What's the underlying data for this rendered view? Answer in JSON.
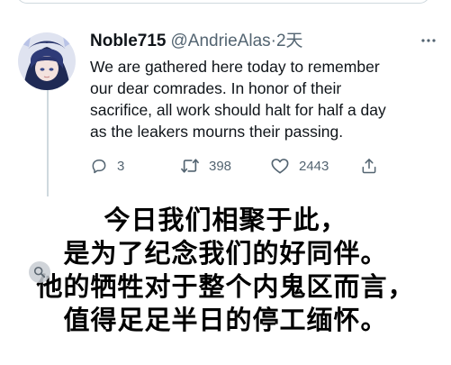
{
  "tweet": {
    "author_name": "Noble715",
    "author_handle": "@AndrieAlas",
    "separator": "·",
    "time": "2天",
    "text_lines": [
      "We are gathered here today to remember",
      "our dear comrades. In honor of their",
      "sacrifice, all work should halt for half a day",
      "as the leakers mourns their passing."
    ],
    "actions": {
      "reply_count": "3",
      "retweet_count": "398",
      "like_count": "2443"
    },
    "icons": {
      "more": "more-horizontal-icon",
      "reply": "reply-icon",
      "retweet": "retweet-icon",
      "like": "heart-icon",
      "share": "share-icon"
    }
  },
  "caption_lines": [
    "今日我们相聚于此，",
    "是为了纪念我们的好同伴。",
    "他的牺牲对于整个内鬼区而言，",
    "值得足足半日的停工缅怀。"
  ],
  "colors": {
    "text_primary": "#0f1419",
    "text_secondary": "#536471",
    "border": "#cfd9de"
  }
}
